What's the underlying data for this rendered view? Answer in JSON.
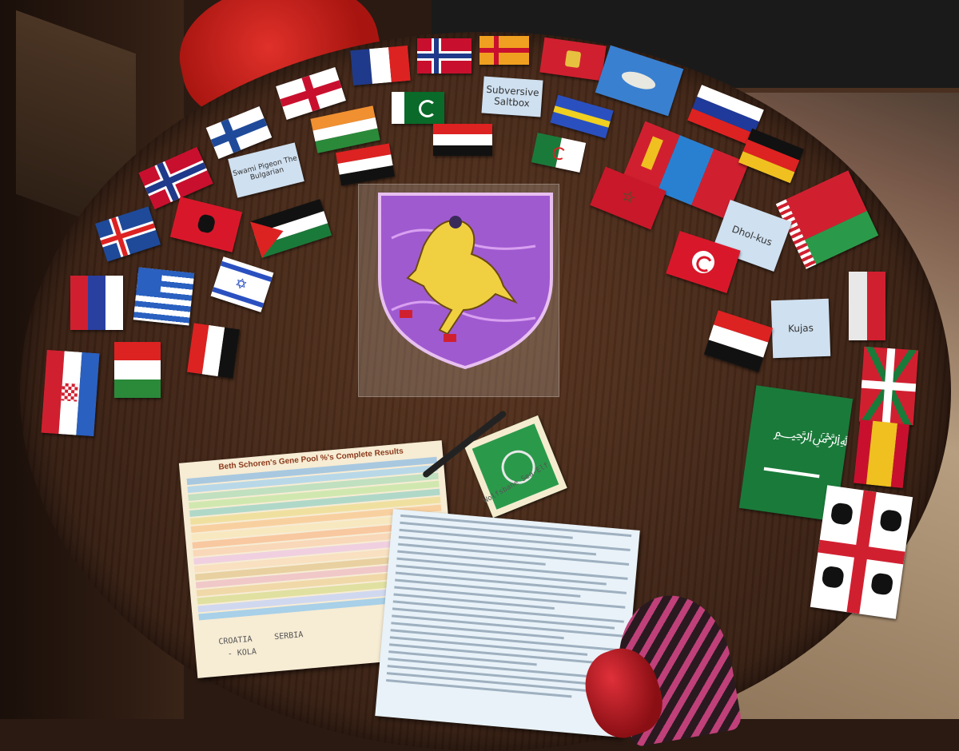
{
  "scene": {
    "description_labels": {
      "results_title": "Beth Schoren's Gene Pool %'s Complete Results",
      "handwritten_croatia": "CROATIA",
      "handwritten_serbia": "SERBIA",
      "handwritten_kola": "- KOLA",
      "note_subversive": "Subversive Saltbox",
      "note_drums": "Dhol-kus",
      "note_kujos": "Kujas",
      "note_bulgaria": "Swami Pigeon The Bulgarian",
      "note_celtic": "Wolfsbane Sea-Elf"
    },
    "colors": {
      "table": "#3e2416",
      "shield_purple": "#a05ad0",
      "horse_yellow": "#f0d040"
    }
  }
}
